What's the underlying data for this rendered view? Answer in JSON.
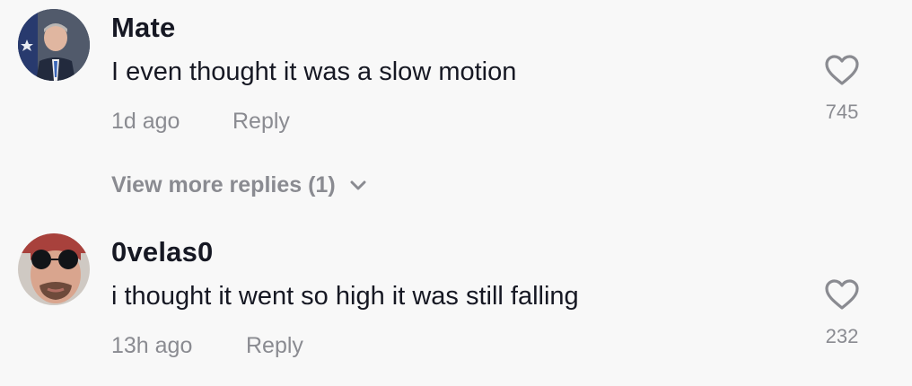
{
  "comments": [
    {
      "username": "Mate",
      "text": "I even thought it was a slow motion",
      "time": "1d ago",
      "reply_label": "Reply",
      "likes": "745",
      "avatar_icon": "avatar-man-with-flag"
    },
    {
      "username": "0velas0",
      "text": "i thought it went so high it was still falling",
      "time": "13h ago",
      "reply_label": "Reply",
      "likes": "232",
      "avatar_icon": "avatar-man-with-sunglasses"
    }
  ],
  "view_more_label": "View more replies (1)",
  "icons": {
    "like": "heart-outline-icon",
    "expand": "chevron-down-icon"
  },
  "colors": {
    "background": "#f8f8f8",
    "primary_text": "#161823",
    "secondary_text": "#8a8b91"
  }
}
